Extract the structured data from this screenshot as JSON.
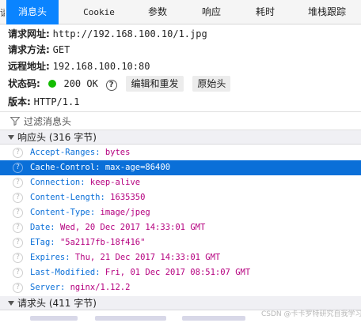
{
  "tabs": [
    {
      "label": "消息头",
      "selected": true
    },
    {
      "label": "Cookie",
      "selected": false
    },
    {
      "label": "参数",
      "selected": false
    },
    {
      "label": "响应",
      "selected": false
    },
    {
      "label": "耗时",
      "selected": false
    },
    {
      "label": "堆栈跟踪",
      "selected": false
    }
  ],
  "tab_edge_glyph": "请",
  "summary": {
    "url_label": "请求网址:",
    "url_value": "http://192.168.100.10/1.jpg",
    "method_label": "请求方法:",
    "method_value": "GET",
    "remote_label": "远程地址:",
    "remote_value": "192.168.100.10:80",
    "status_label": "状态码:",
    "status_value": "200 OK",
    "status_color": "#12bc00",
    "help_glyph": "?",
    "edit_resend_label": "编辑和重发",
    "raw_headers_label": "原始头",
    "version_label": "版本:",
    "version_value": "HTTP/1.1"
  },
  "filter": {
    "placeholder": "过滤消息头",
    "icon": "funnel-icon"
  },
  "response_section": {
    "title": "响应头 (316 字节)"
  },
  "response_headers": [
    {
      "name": "Accept-Ranges",
      "value": "bytes",
      "selected": false
    },
    {
      "name": "Cache-Control",
      "value": "max-age=86400",
      "selected": true
    },
    {
      "name": "Connection",
      "value": "keep-alive",
      "selected": false
    },
    {
      "name": "Content-Length",
      "value": "1635350",
      "selected": false
    },
    {
      "name": "Content-Type",
      "value": "image/jpeg",
      "selected": false
    },
    {
      "name": "Date",
      "value": "Wed, 20 Dec 2017 14:33:01 GMT",
      "selected": false
    },
    {
      "name": "ETag",
      "value": "\"5a2117fb-18f416\"",
      "selected": false
    },
    {
      "name": "Expires",
      "value": "Thu, 21 Dec 2017 14:33:01 GMT",
      "selected": false
    },
    {
      "name": "Last-Modified",
      "value": "Fri, 01 Dec 2017 08:51:07 GMT",
      "selected": false
    },
    {
      "name": "Server",
      "value": "nginx/1.12.2",
      "selected": false
    }
  ],
  "request_section": {
    "title": "请求头 (411 字节)"
  },
  "watermark": "CSDN @卡卡罗特研究自我学习",
  "colors": {
    "accent": "#0a84ff",
    "selected_row": "#0a6fd8",
    "header_name": "#0a6fd8",
    "header_value": "#b5007f"
  }
}
